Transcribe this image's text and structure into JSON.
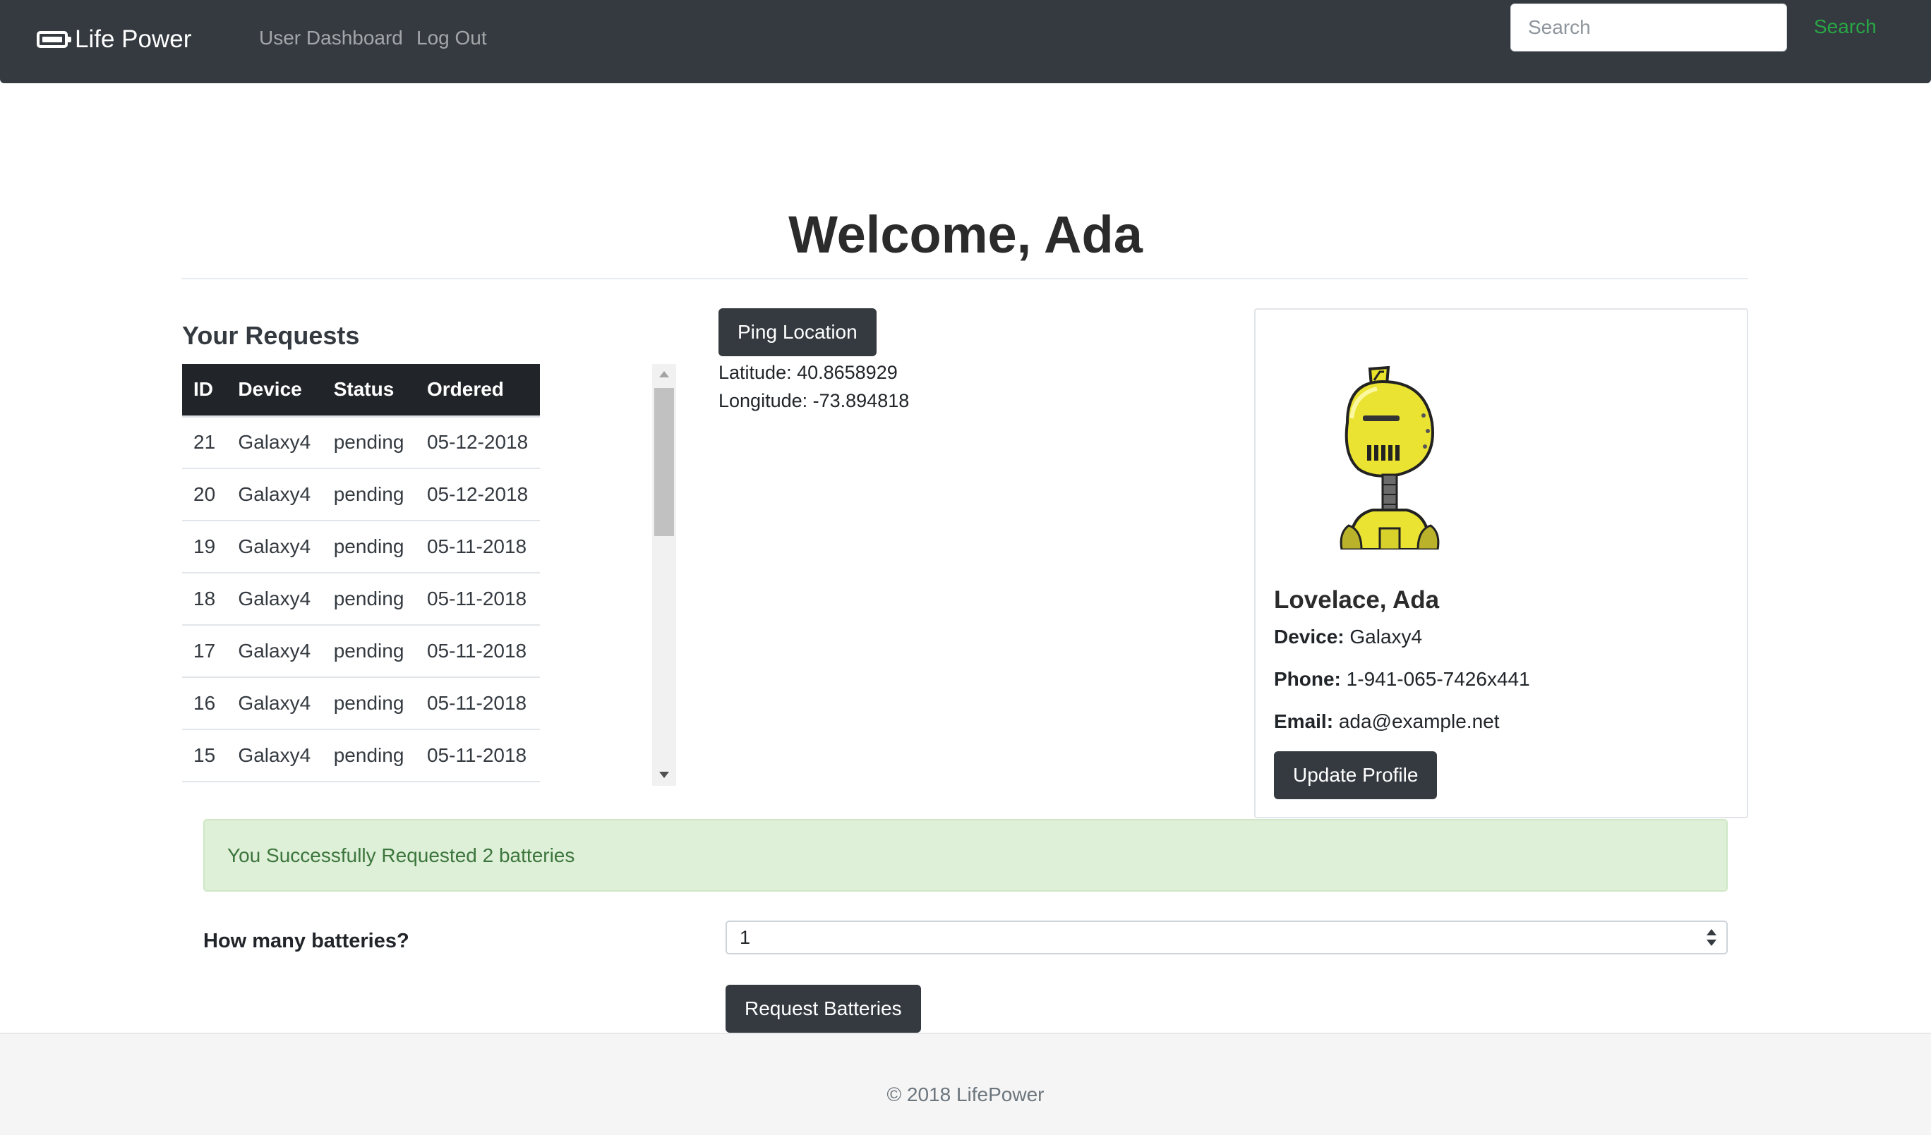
{
  "navbar": {
    "brand": "Life Power",
    "links": [
      "User Dashboard",
      "Log Out"
    ],
    "search_placeholder": "Search",
    "search_button": "Search"
  },
  "heading": "Welcome, Ada",
  "requests": {
    "title": "Your Requests",
    "columns": [
      "ID",
      "Device",
      "Status",
      "Ordered"
    ],
    "rows": [
      [
        "21",
        "Galaxy4",
        "pending",
        "05-12-2018"
      ],
      [
        "20",
        "Galaxy4",
        "pending",
        "05-12-2018"
      ],
      [
        "19",
        "Galaxy4",
        "pending",
        "05-11-2018"
      ],
      [
        "18",
        "Galaxy4",
        "pending",
        "05-11-2018"
      ],
      [
        "17",
        "Galaxy4",
        "pending",
        "05-11-2018"
      ],
      [
        "16",
        "Galaxy4",
        "pending",
        "05-11-2018"
      ],
      [
        "15",
        "Galaxy4",
        "pending",
        "05-11-2018"
      ]
    ]
  },
  "location": {
    "ping_button": "Ping Location",
    "latitude": "Latitude: 40.8658929",
    "longitude": "Longitude: -73.894818"
  },
  "profile": {
    "avatar_icon": "robot-avatar-icon",
    "name": "Lovelace, Ada",
    "device_label": "Device:",
    "device": "Galaxy4",
    "phone_label": "Phone:",
    "phone": "1-941-065-7426x441",
    "email_label": "Email:",
    "email": "ada@example.net",
    "update_button": "Update Profile"
  },
  "alert": {
    "message": "You Successfully Requested 2 batteries"
  },
  "form": {
    "label": "How many batteries?",
    "selected": "1",
    "submit_button": "Request Batteries"
  },
  "footer": {
    "text": "© 2018 LifePower"
  },
  "colors": {
    "navbar": "#343a40",
    "success": "#28a745",
    "alert_bg": "#dff0d8",
    "alert_text": "#3c763d",
    "button": "#343a40"
  }
}
